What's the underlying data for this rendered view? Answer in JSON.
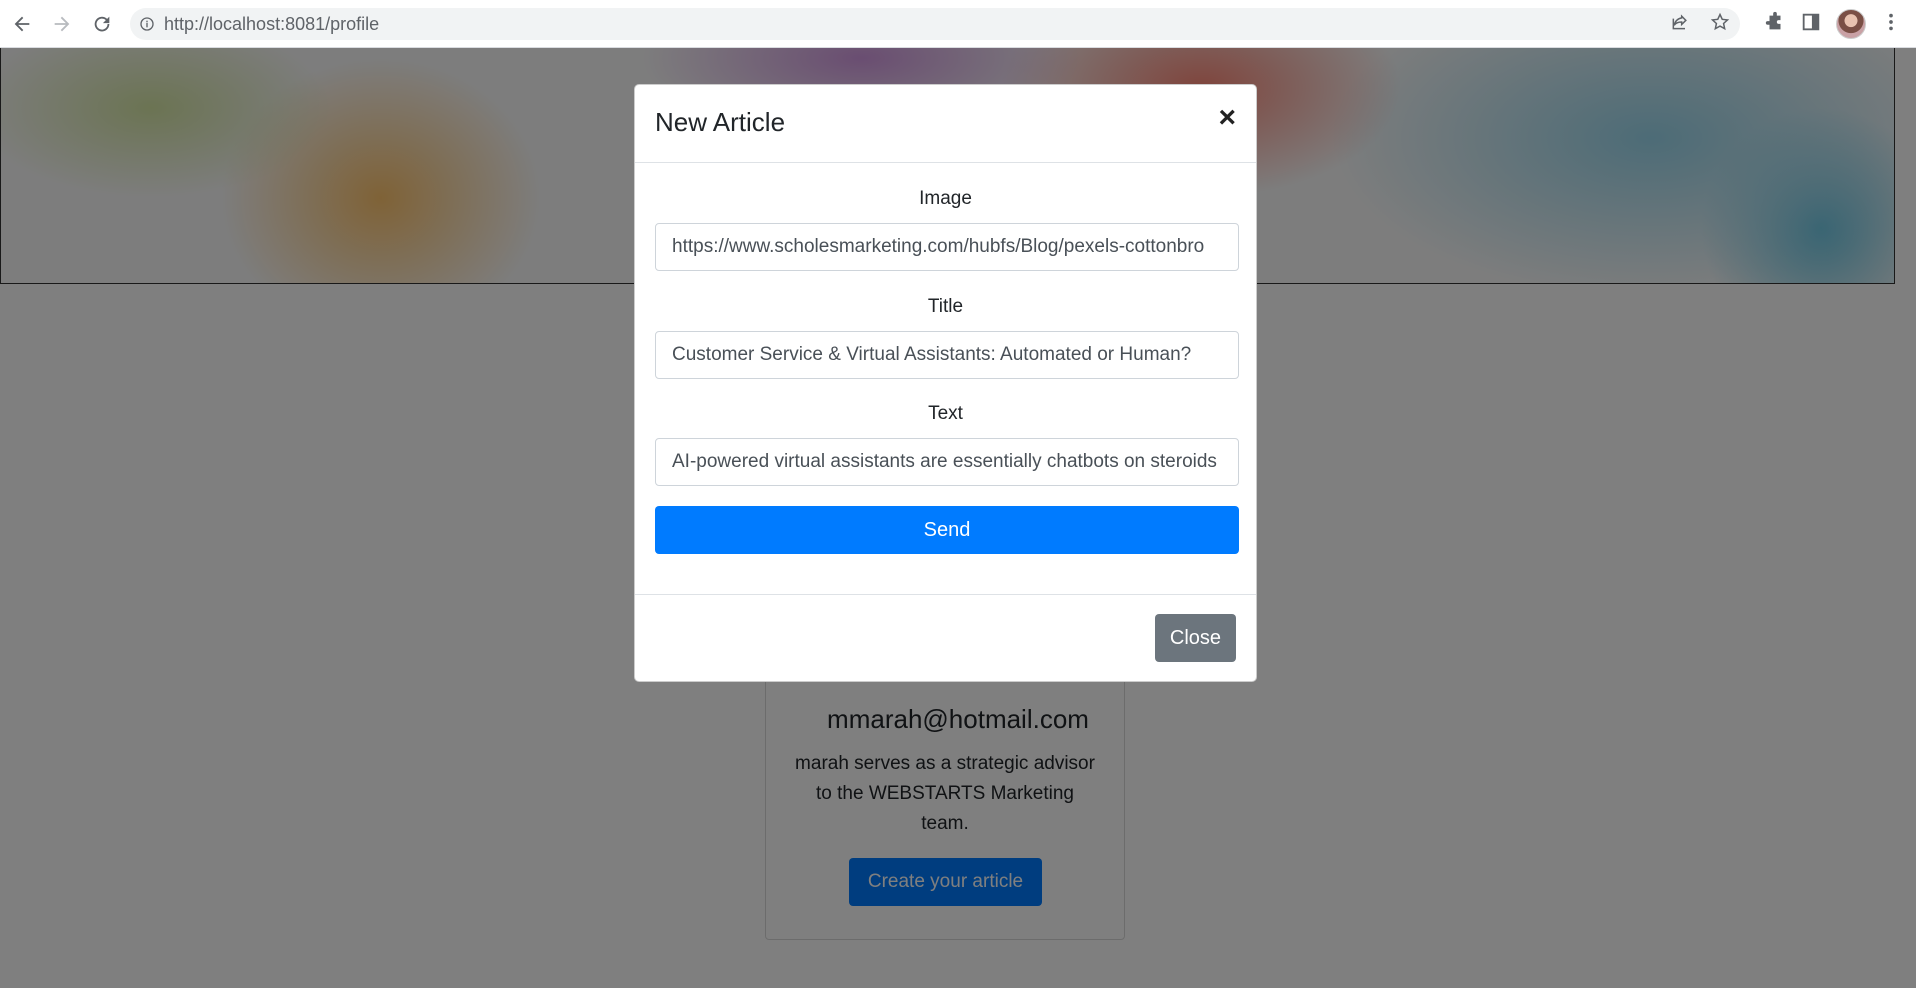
{
  "browser": {
    "url_host": "http://localhost:8081",
    "url_path": "/profile"
  },
  "profile": {
    "name": "marah",
    "email": "mmarah@hotmail.com",
    "bio": "marah serves as a strategic advisor to the WEBSTARTS Marketing team.",
    "create_button": "Create your article"
  },
  "modal": {
    "title": "New Article",
    "close_x": "×",
    "image_label": "Image",
    "image_value": "https://www.scholesmarketing.com/hubfs/Blog/pexels-cottonbro",
    "title_label": "Title",
    "title_value": "Customer Service & Virtual Assistants: Automated or Human?",
    "text_label": "Text",
    "text_value": "AI-powered virtual assistants are essentially chatbots on steroids",
    "send_button": "Send",
    "close_button": "Close"
  },
  "colors": {
    "primary": "#007bff",
    "secondary": "#6c757d",
    "backdrop": "rgba(0,0,0,0.5)"
  }
}
